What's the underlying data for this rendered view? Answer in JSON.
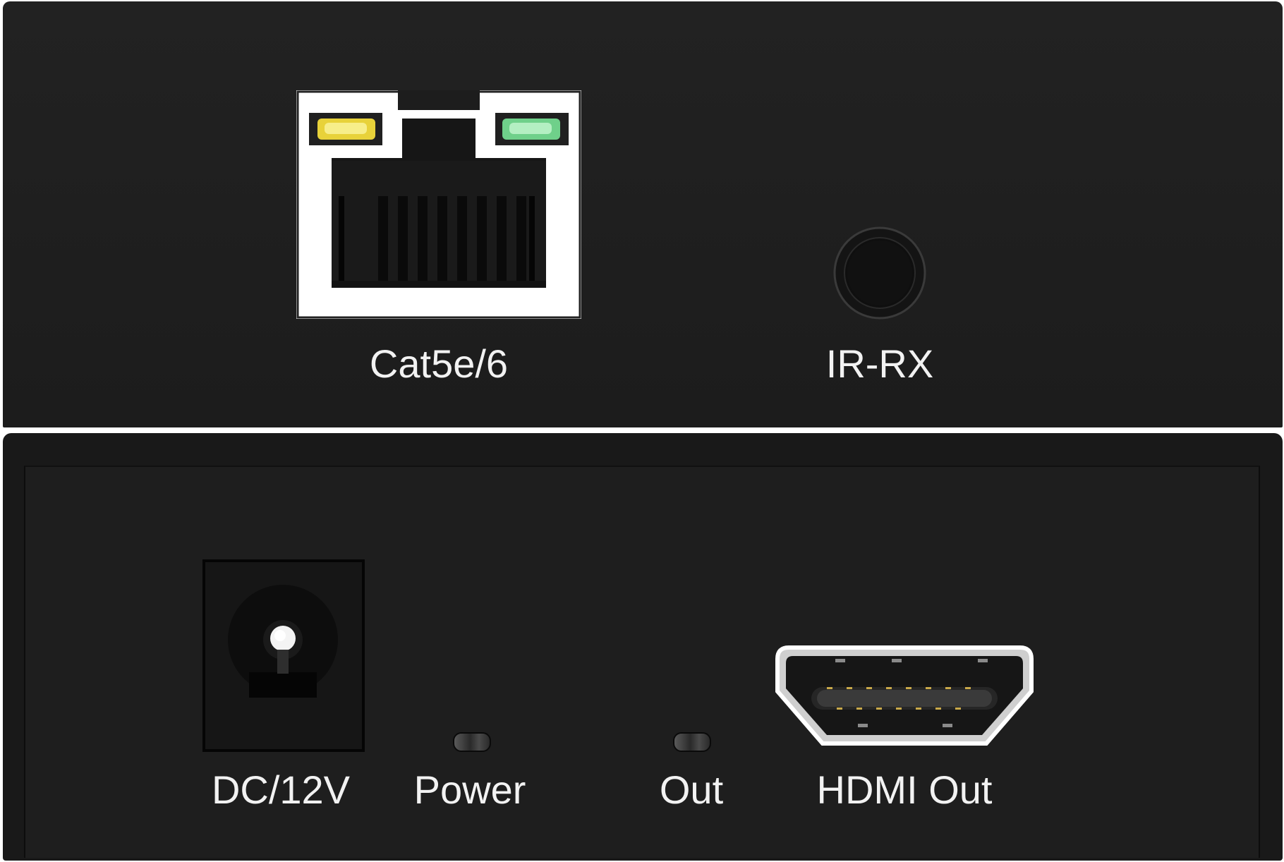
{
  "top_panel": {
    "ethernet_label": "Cat5e/6",
    "ir_label": "IR-RX",
    "led_colors": {
      "left": "#e8d23a",
      "right": "#6fd08a"
    }
  },
  "bottom_panel": {
    "dc_label": "DC/12V",
    "power_label": "Power",
    "out_label": "Out",
    "hdmi_label": "HDMI Out"
  },
  "colors": {
    "chassis": "#1d1d1d",
    "text": "#f2f2f2",
    "port_frame": "#ffffff"
  }
}
